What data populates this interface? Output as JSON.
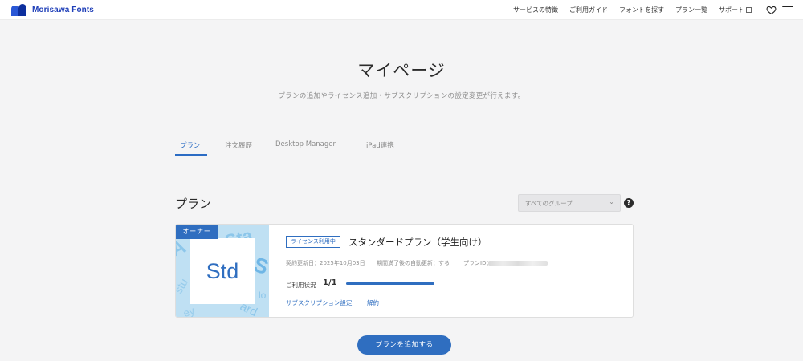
{
  "header": {
    "brand": "Morisawa Fonts",
    "nav": [
      {
        "label": "サービスの特徴"
      },
      {
        "label": "ご利用ガイド"
      },
      {
        "label": "フォントを探す"
      },
      {
        "label": "プラン一覧"
      },
      {
        "label": "サポート"
      }
    ],
    "icons": [
      "logo-icon",
      "external-link-icon",
      "heart-icon",
      "menu-icon"
    ]
  },
  "page": {
    "title": "マイページ",
    "description": "プランの追加やライセンス追加・サブスクリプションの設定変更が行えます。"
  },
  "tabs": [
    {
      "label": "プラン",
      "active": true
    },
    {
      "label": "注文履歴",
      "active": false
    },
    {
      "label": "Desktop Manager",
      "active": false
    },
    {
      "label": "iPad連携",
      "active": false
    }
  ],
  "plans_section": {
    "title": "プラン",
    "group_select": {
      "selected": "すべてのグループ"
    },
    "help": "?"
  },
  "plan_card": {
    "owner_badge": "オーナー",
    "thumbnail_text": "Std",
    "status": "ライセンス利用中",
    "name": "スタンダードプラン（学生向け）",
    "renewal": "契約更新日：2025年10月03日",
    "auto_renew": "期間満了後の自動更新：する",
    "plan_id_label": "プランID：",
    "usage_label": "ご利用状況",
    "usage_count": "1/1",
    "usage_ratio": 1.0,
    "links": {
      "subscription": "サブスクリプション設定",
      "cancel": "解約"
    }
  },
  "add_plan_button": "プランを追加する",
  "colors": {
    "accent": "#2f6ec0",
    "brand": "#1f3fb8",
    "background": "#f4f4f5"
  }
}
